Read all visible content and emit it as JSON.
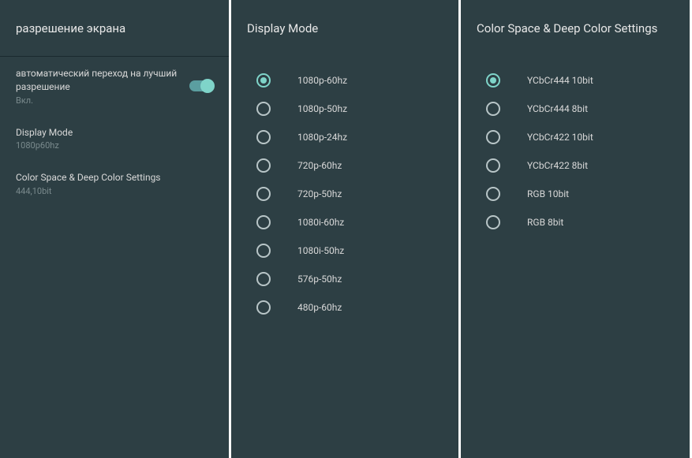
{
  "panel1": {
    "title": "разрешение экрана",
    "settings": [
      {
        "title": "автоматический переход на лучший разрешение",
        "subtitle": "Вкл.",
        "type": "toggle",
        "value": true
      },
      {
        "title": "Display Mode",
        "subtitle": "1080p60hz",
        "type": "link"
      },
      {
        "title": "Color Space & Deep Color Settings",
        "subtitle": "444,10bit",
        "type": "link"
      }
    ]
  },
  "panel2": {
    "title": "Display Mode",
    "selectedIndex": 0,
    "options": [
      "1080p-60hz",
      "1080p-50hz",
      "1080p-24hz",
      "720p-60hz",
      "720p-50hz",
      "1080i-60hz",
      "1080i-50hz",
      "576p-50hz",
      "480p-60hz"
    ]
  },
  "panel3": {
    "title": "Color Space & Deep Color Settings",
    "selectedIndex": 0,
    "options": [
      "YCbCr444 10bit",
      "YCbCr444 8bit",
      "YCbCr422 10bit",
      "YCbCr422 8bit",
      "RGB 10bit",
      "RGB 8bit"
    ]
  }
}
